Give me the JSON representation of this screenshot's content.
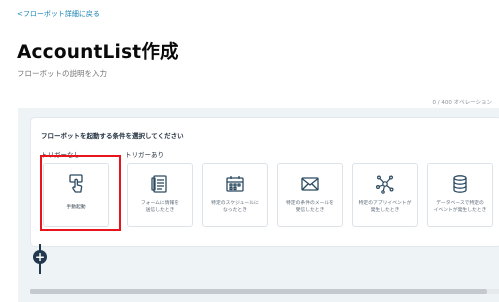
{
  "back_link": "<フローボット詳細に戻る",
  "title": "AccountList作成",
  "description": {
    "value": "",
    "placeholder": "フローボットの説明を入力"
  },
  "operation_count": "0 / 400 オペレーション",
  "trigger_panel": {
    "heading": "フローボットを起動する条件を選択してください",
    "no_trigger_label": "トリガーなし",
    "trigger_label": "トリガーあり",
    "cards": [
      {
        "id": "manual",
        "icon": "hand-pointer-icon",
        "label": "手動起動",
        "selected": true
      },
      {
        "id": "form",
        "icon": "form-icon",
        "label": "フォームに情報を\n送信したとき"
      },
      {
        "id": "schedule",
        "icon": "calendar-schedule-icon",
        "label": "特定のスケジュールに\nなったとき"
      },
      {
        "id": "email",
        "icon": "mail-icon",
        "label": "特定の条件のメールを\n受信したとき"
      },
      {
        "id": "app-event",
        "icon": "app-network-icon",
        "label": "特定のアプリイベントが\n発生したとき"
      },
      {
        "id": "database",
        "icon": "database-icon",
        "label": "データベースで特定の\nイベントが発生したとき"
      }
    ]
  },
  "add_step_symbol": "+",
  "colors": {
    "link": "#0f7fb3",
    "highlight": "#e8141c",
    "accent_dark": "#22384f",
    "canvas_bg": "#eef3f5"
  }
}
